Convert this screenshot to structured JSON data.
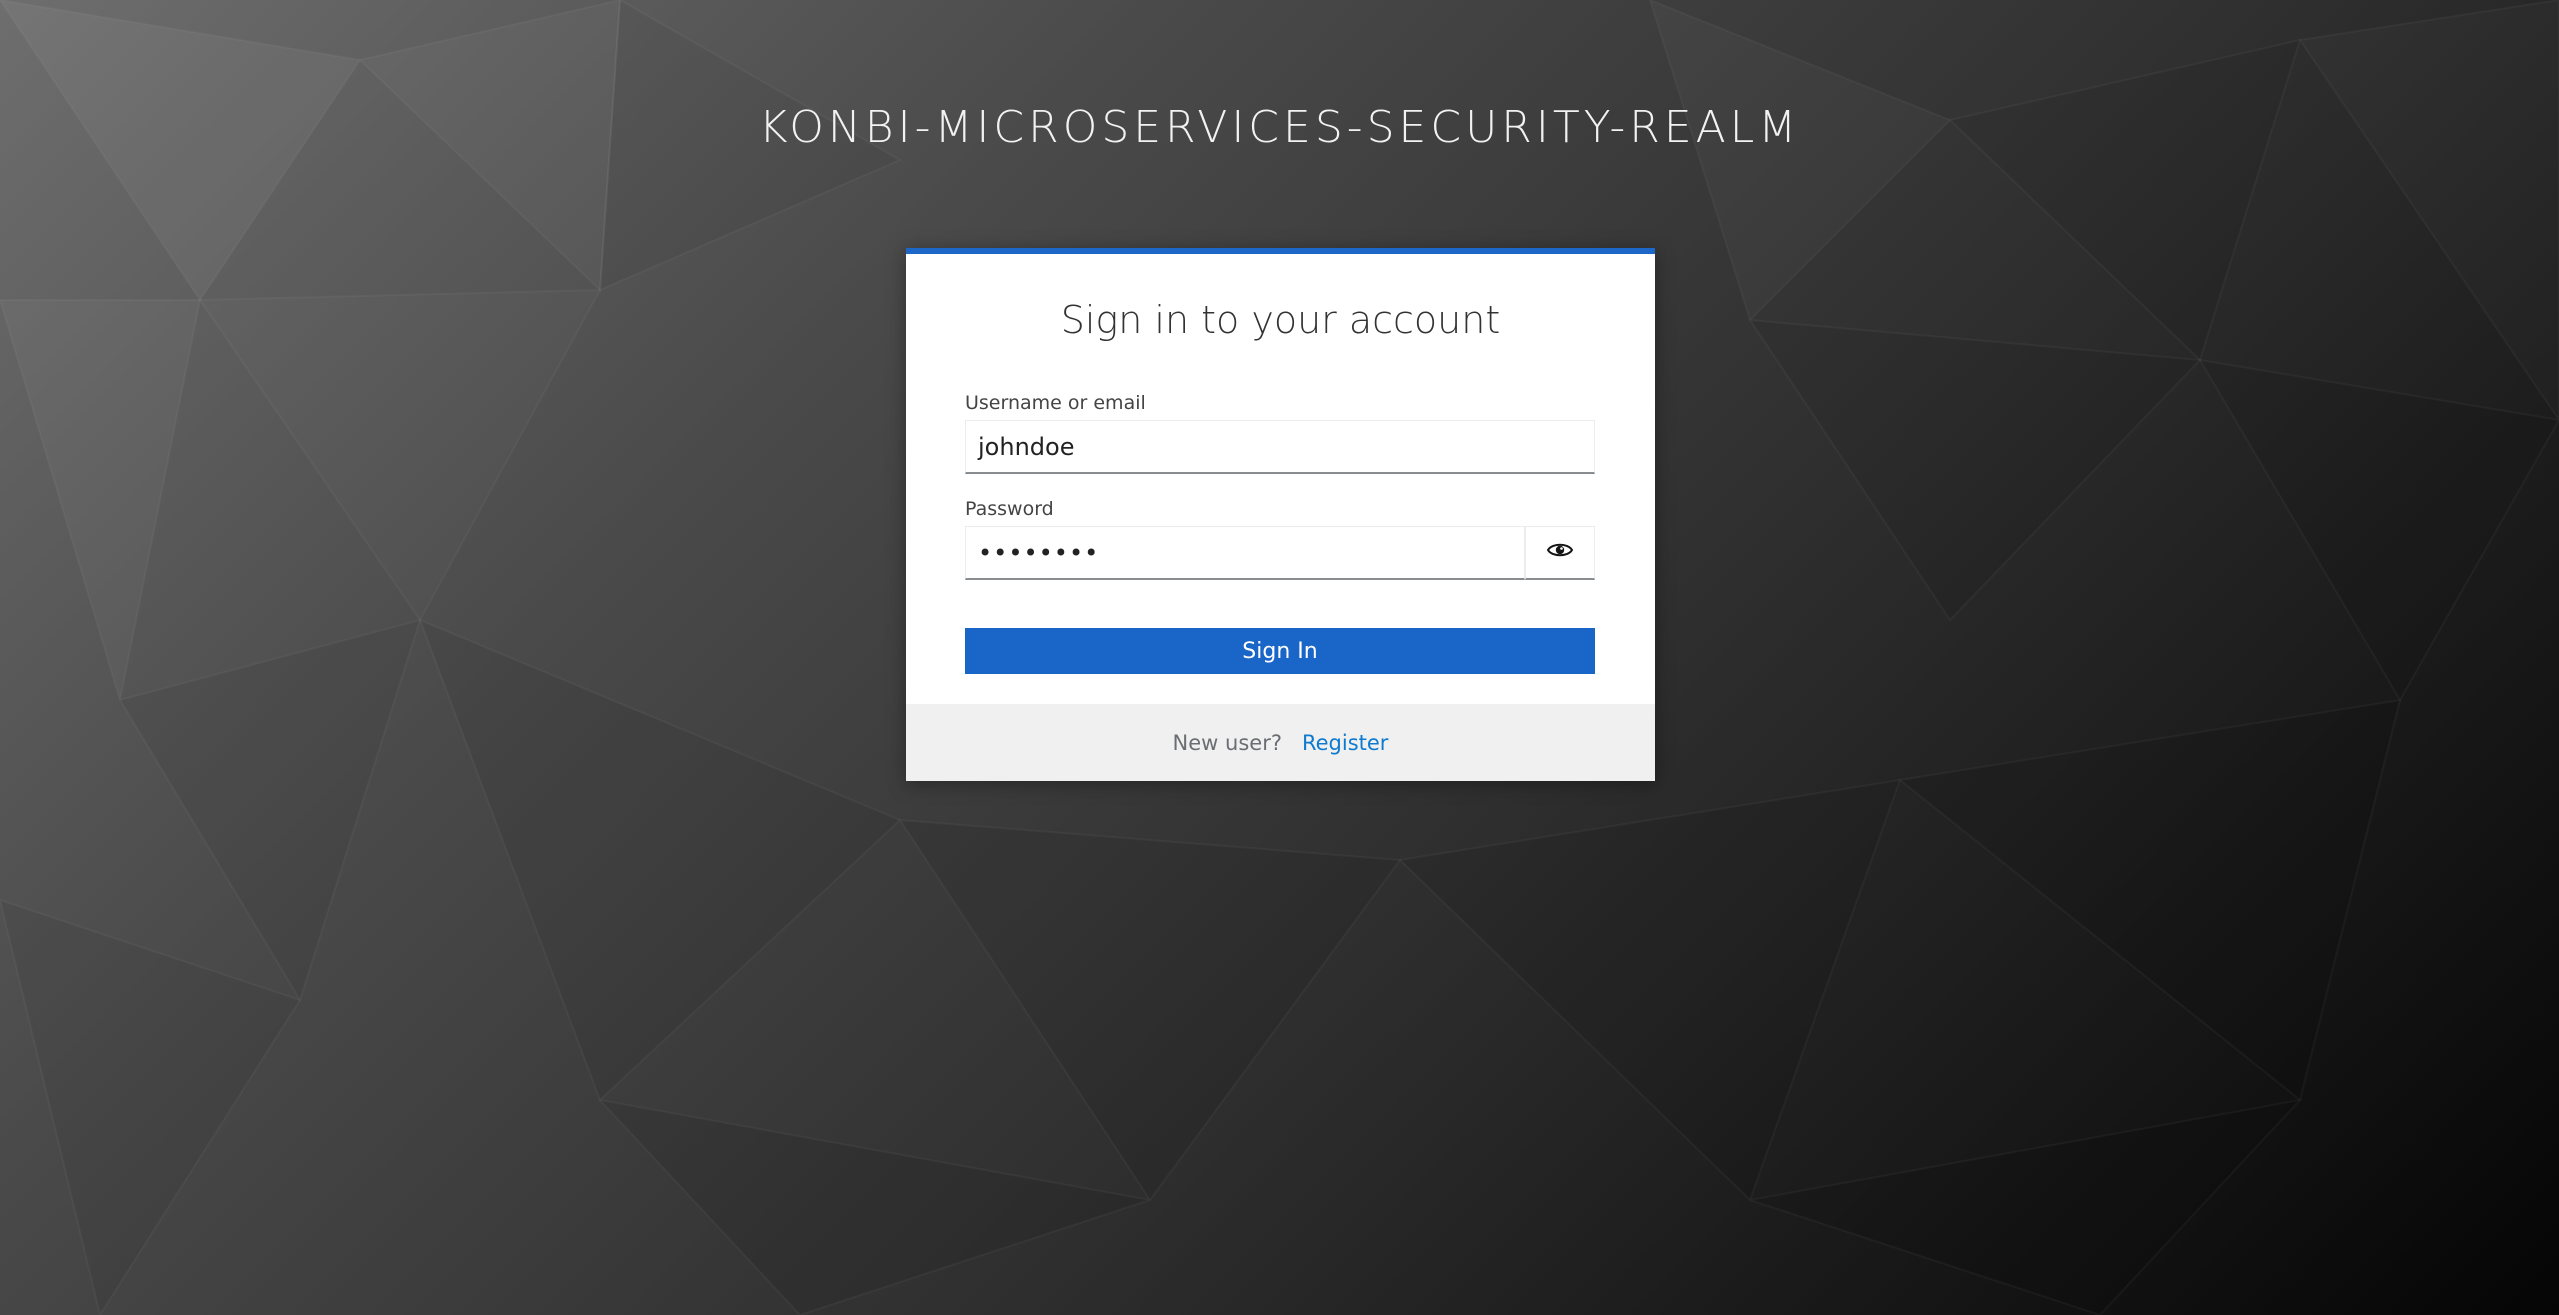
{
  "realm": {
    "title": "KONBI-MICROSERVICES-SECURITY-REALM"
  },
  "login": {
    "heading": "Sign in to your account",
    "username": {
      "label": "Username or email",
      "value": "johndoe"
    },
    "password": {
      "label": "Password",
      "value": "••••••••"
    },
    "show_password_icon": "eye-icon",
    "sign_in_label": "Sign In",
    "footer": {
      "prompt": "New user?",
      "register_label": "Register"
    }
  },
  "colors": {
    "accent": "#1a65c8",
    "link": "#0e7ad0",
    "footer_bg": "#f0f0f0"
  }
}
